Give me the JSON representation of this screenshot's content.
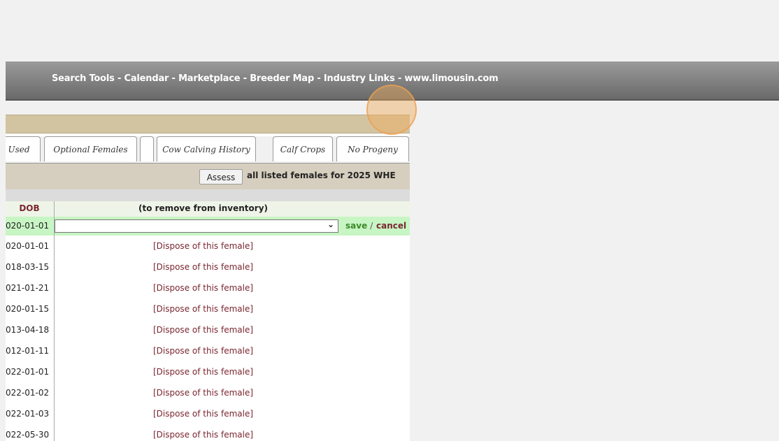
{
  "topnav": {
    "text": "Search Tools - Calendar - Marketplace - Breeder Map - Industry Links - www.limousin.com"
  },
  "tabs": [
    {
      "label": "Used"
    },
    {
      "label": "Optional Females"
    },
    {
      "label": ""
    },
    {
      "label": "Cow Calving History"
    },
    {
      "label": "Calf Crops"
    },
    {
      "label": "No Progeny"
    }
  ],
  "assess": {
    "button_label": "Assess",
    "text": "all listed females for 2025 WHE"
  },
  "table": {
    "dob_header": "DOB",
    "remove_header": "(to remove from inventory)",
    "edit_row": {
      "dob": "020-01-01",
      "select_value": "",
      "save_label": "save",
      "separator": "/",
      "cancel_label": "cancel"
    },
    "rows": [
      {
        "dob": "020-01-01",
        "action": "[Dispose of this female]"
      },
      {
        "dob": "018-03-15",
        "action": "[Dispose of this female]"
      },
      {
        "dob": "021-01-21",
        "action": "[Dispose of this female]"
      },
      {
        "dob": "020-01-15",
        "action": "[Dispose of this female]"
      },
      {
        "dob": "013-04-18",
        "action": "[Dispose of this female]"
      },
      {
        "dob": "012-01-11",
        "action": "[Dispose of this female]"
      },
      {
        "dob": "022-01-01",
        "action": "[Dispose of this female]"
      },
      {
        "dob": "022-01-02",
        "action": "[Dispose of this female]"
      },
      {
        "dob": "022-01-03",
        "action": "[Dispose of this female]"
      },
      {
        "dob": "022-05-30",
        "action": "[Dispose of this female]"
      }
    ]
  },
  "colors": {
    "accent_maroon": "#7a2630",
    "save_green": "#3a8a2a",
    "edit_row_bg": "#c8f5c4",
    "tan_bar": "#d3c4a1",
    "highlight": "#f0aa5a"
  }
}
